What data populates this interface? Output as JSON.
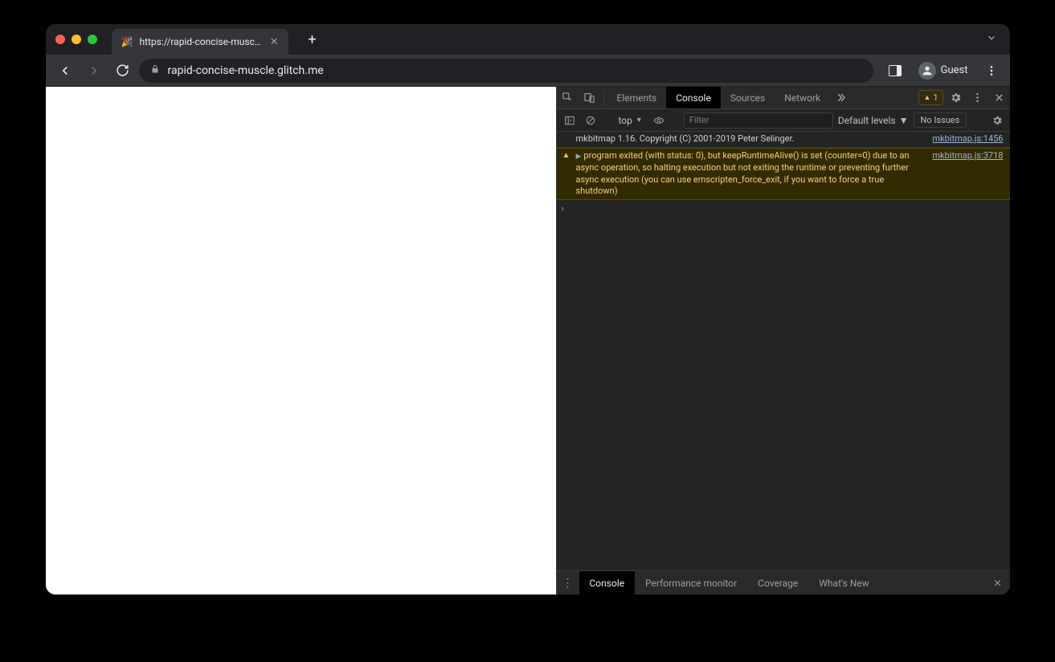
{
  "tab": {
    "favicon": "🎉",
    "title": "https://rapid-concise-muscle.g"
  },
  "toolbar": {
    "url": "rapid-concise-muscle.glitch.me",
    "guest_label": "Guest"
  },
  "devtools": {
    "tabs": {
      "elements": "Elements",
      "console": "Console",
      "sources": "Sources",
      "network": "Network"
    },
    "warning_count": "1",
    "console_toolbar": {
      "context": "top",
      "filter_placeholder": "Filter",
      "levels": "Default levels",
      "issues": "No Issues"
    },
    "messages": {
      "log1": {
        "text": "mkbitmap 1.16. Copyright (C) 2001-2019 Peter Selinger.",
        "src": "mkbitmap.js:1456"
      },
      "warn1": {
        "text": "program exited (with status: 0), but keepRuntimeAlive() is set (counter=0) due to an async operation, so halting execution but not exiting the runtime or preventing further async execution (you can use emscripten_force_exit, if you want to force a true shutdown)",
        "src": "mkbitmap.js:3718"
      }
    },
    "drawer": {
      "console": "Console",
      "perf": "Performance monitor",
      "coverage": "Coverage",
      "whatsnew": "What's New"
    }
  }
}
